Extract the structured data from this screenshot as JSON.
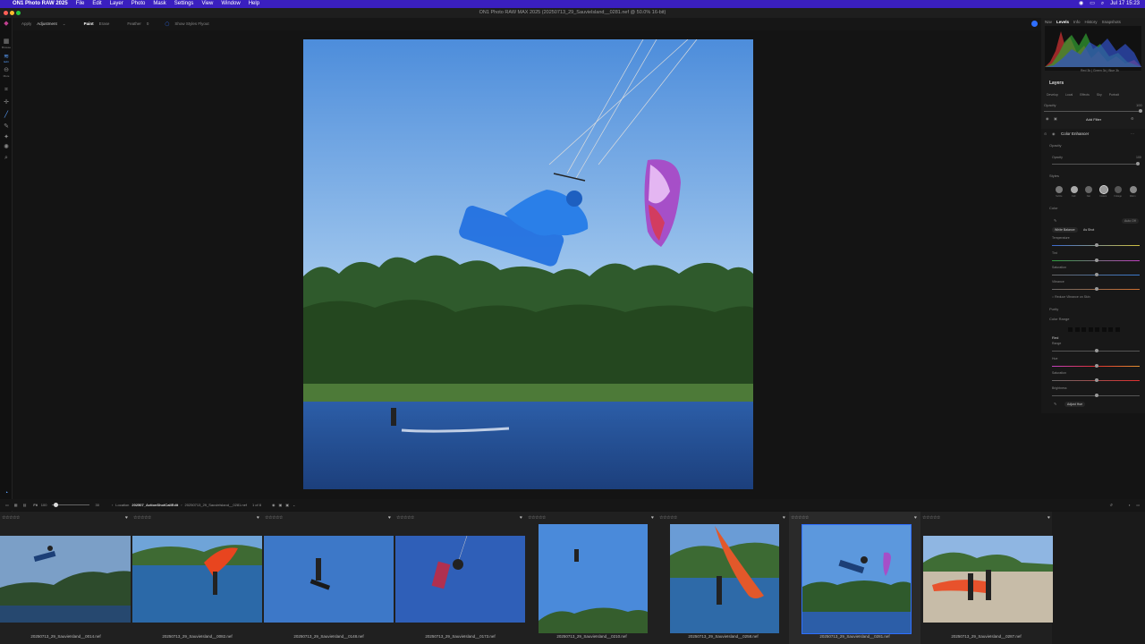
{
  "menubar": {
    "items": [
      "ON1 Photo RAW 2025",
      "File",
      "Edit",
      "Layer",
      "Photo",
      "Mask",
      "Settings",
      "View",
      "Window",
      "Help"
    ],
    "clock": "Jul 17  15:23"
  },
  "window": {
    "title": "ON1 Photo RAW MAX 2025 (20250713_29_Sauvielsland__0281.nef @ 50.0% 16-bit)"
  },
  "toolbar": {
    "apply_label": "Apply",
    "apply_value": "Adjustment",
    "paint": "Paint",
    "erase": "Erase",
    "feather": "Feather",
    "feather_value": "0",
    "styles_flyout": "Show Styles Flyout"
  },
  "leftbar": {
    "browse": "Browse",
    "edit": "Edit",
    "more": "More"
  },
  "rightpanel": {
    "tabs": [
      "Nav",
      "Levels",
      "Info",
      "History",
      "Snapshots"
    ],
    "active_tab": "Levels",
    "histogram_readout": "Red 3k | Green 3k | Blue 3k",
    "layers_heading": "Layers",
    "layer_tabs": [
      "Develop",
      "Local",
      "Effects",
      "Sky",
      "Portrait"
    ],
    "opacity_label": "Opacity",
    "opacity_value": "100",
    "add_filter": "Add Filter",
    "filter_name": "Color Enhancer",
    "filter_opacity_section": "Opacity",
    "filter_opacity_label": "Opacity",
    "filter_opacity_value": "100",
    "styles_label": "Styles",
    "style_names": [
      "Subtle",
      "Fall",
      "Nat",
      "Instant",
      "Foliage",
      "Warm"
    ],
    "color_label": "Color",
    "auto_off": "Auto Off",
    "white_balance": "White Balance",
    "as_shot": "As Shot",
    "temperature": "Temperature",
    "tint": "Tint",
    "saturation": "Saturation",
    "vibrance": "Vibrance",
    "reduce_vibrance": "Reduce Vibrance on Skin",
    "purity": "Purity",
    "color_range": "Color Range",
    "red": "Red",
    "range": "Range",
    "hue": "Hue",
    "range_saturation": "Saturation",
    "brightness": "Brightness",
    "adjust_hue": "Adjust Hue"
  },
  "filmbar": {
    "zoom_value": "30",
    "fit": "Fit",
    "zoom_pct": "100",
    "location_label": "Location",
    "location_path": "202507_ActionShotCallEdit",
    "location_file": "20250713_29_Sauvielsland__0281.nef",
    "count": "1 of 8"
  },
  "thumbnails": [
    {
      "name": "20250713_29_SauvieIsland__0014.nef",
      "stars": "☆☆☆☆☆"
    },
    {
      "name": "20250713_29_SauvieIsland__0082.nef",
      "stars": "☆☆☆☆☆"
    },
    {
      "name": "20250713_29_SauvieIsland__0148.nef",
      "stars": "☆☆☆☆☆"
    },
    {
      "name": "20250713_29_SauvieIsland__0173.nef",
      "stars": "☆☆☆☆☆"
    },
    {
      "name": "20250713_29_SauvieIsland__0210.nef",
      "stars": "☆☆☆☆☆"
    },
    {
      "name": "20250713_29_SauvieIsland__0258.nef",
      "stars": "☆☆☆☆☆"
    },
    {
      "name": "20250713_29_SauvieIsland__0281.nef",
      "stars": "☆☆☆☆☆"
    },
    {
      "name": "20250713_29_SauvieIsland__0287.nef",
      "stars": "☆☆☆☆☆"
    }
  ],
  "colors": {
    "accent": "#2f6fff",
    "menubar": "#3a1fbf",
    "sky": "#5c98dd"
  }
}
